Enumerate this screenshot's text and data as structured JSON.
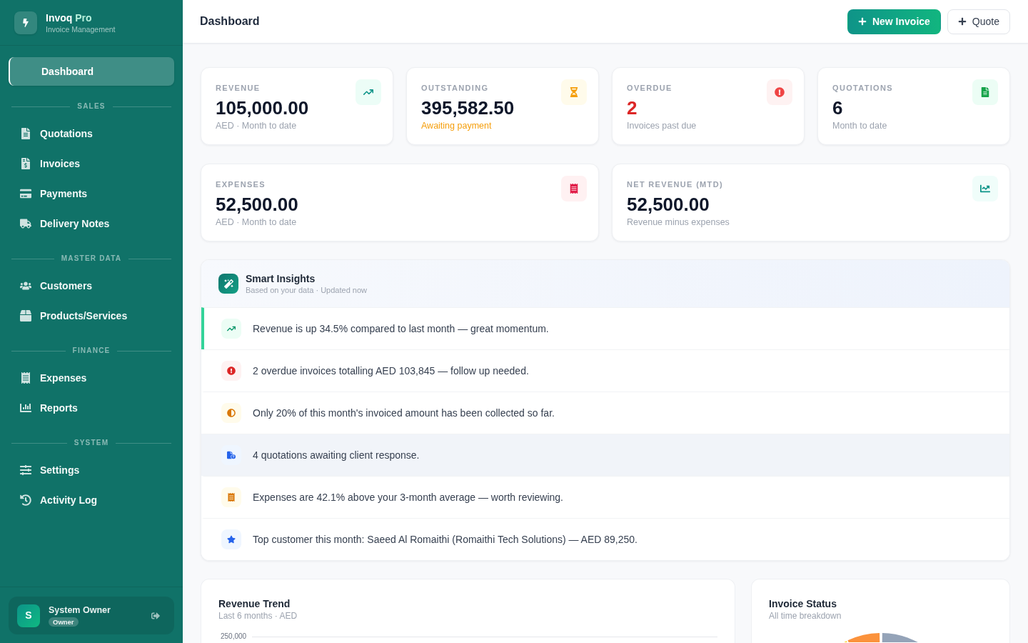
{
  "brand": {
    "name": "Invoq",
    "name_accent": "Pro",
    "tagline": "Invoice Management"
  },
  "sidebar": {
    "items": [
      {
        "label": "Dashboard",
        "selected": true
      }
    ],
    "sections": [
      {
        "title": "SALES",
        "items": [
          {
            "label": "Quotations",
            "kind": "quotations",
            "selected": false
          },
          {
            "label": "Invoices",
            "kind": "invoices",
            "selected": false
          },
          {
            "label": "Payments",
            "kind": "payments",
            "selected": false
          },
          {
            "label": "Delivery Notes",
            "kind": "delivery",
            "selected": false
          }
        ]
      },
      {
        "title": "MASTER DATA",
        "items": [
          {
            "label": "Customers",
            "kind": "customers",
            "selected": false
          },
          {
            "label": "Products/Services",
            "kind": "products",
            "selected": false
          }
        ]
      },
      {
        "title": "FINANCE",
        "items": [
          {
            "label": "Expenses",
            "kind": "expenses",
            "selected": false
          },
          {
            "label": "Reports",
            "kind": "reports",
            "selected": false
          }
        ]
      },
      {
        "title": "SYSTEM",
        "items": [
          {
            "label": "Settings",
            "kind": "settings",
            "selected": false
          },
          {
            "label": "Activity Log",
            "kind": "activity",
            "selected": false
          }
        ]
      }
    ]
  },
  "user": {
    "initial": "S",
    "name": "System Owner",
    "role": "Owner"
  },
  "header": {
    "title": "Dashboard",
    "actions": [
      {
        "label": "New Invoice",
        "kind": "primary"
      },
      {
        "label": "Quote",
        "kind": "secondary"
      }
    ]
  },
  "stat_rows": [
    {
      "cards": [
        {
          "kind": "revenue",
          "label": "REVENUE",
          "value": "105,000.00",
          "note": "AED · Month to date"
        },
        {
          "kind": "outstanding",
          "label": "OUTSTANDING",
          "value": "395,582.50",
          "note": "Awaiting payment"
        },
        {
          "kind": "overdue",
          "label": "OVERDUE",
          "value": "2",
          "note": "Invoices past due"
        },
        {
          "kind": "quotations",
          "label": "QUOTATIONS",
          "value": "6",
          "note": "Month to date"
        }
      ]
    },
    {
      "cards": [
        {
          "kind": "expenses",
          "label": "EXPENSES",
          "value": "52,500.00",
          "note": "AED · Month to date"
        },
        {
          "kind": "net",
          "label": "NET REVENUE (MTD)",
          "value": "52,500.00",
          "note": "Revenue minus expenses"
        }
      ]
    }
  ],
  "insights": {
    "title": "Smart Insights",
    "subtitle": "Based on your data · Updated now",
    "items": [
      {
        "kind": "trend",
        "text": "Revenue is up 34.5% compared to last month — great momentum.",
        "accented": true,
        "hovered": false
      },
      {
        "kind": "overdue",
        "text": "2 overdue invoices totalling AED 103,845 — follow up needed.",
        "accented": false,
        "hovered": false
      },
      {
        "kind": "collection",
        "text": "Only 20% of this month's invoiced amount has been collected so far.",
        "accented": false,
        "hovered": false
      },
      {
        "kind": "quotes",
        "text": "4 quotations awaiting client response.",
        "accented": false,
        "hovered": true
      },
      {
        "kind": "expenses",
        "text": "Expenses are 42.1% above your 3-month average — worth reviewing.",
        "accented": false,
        "hovered": false
      },
      {
        "kind": "customer",
        "text": "Top customer this month: Saeed Al Romaithi (Romaithi Tech Solutions) — AED 89,250.",
        "accented": false,
        "hovered": false
      }
    ]
  },
  "revenue_trend": {
    "title": "Revenue Trend",
    "subtitle": "Last 6 months · AED",
    "top_tick": "250,000"
  },
  "invoice_status": {
    "title": "Invoice Status",
    "subtitle": "All time breakdown"
  }
}
